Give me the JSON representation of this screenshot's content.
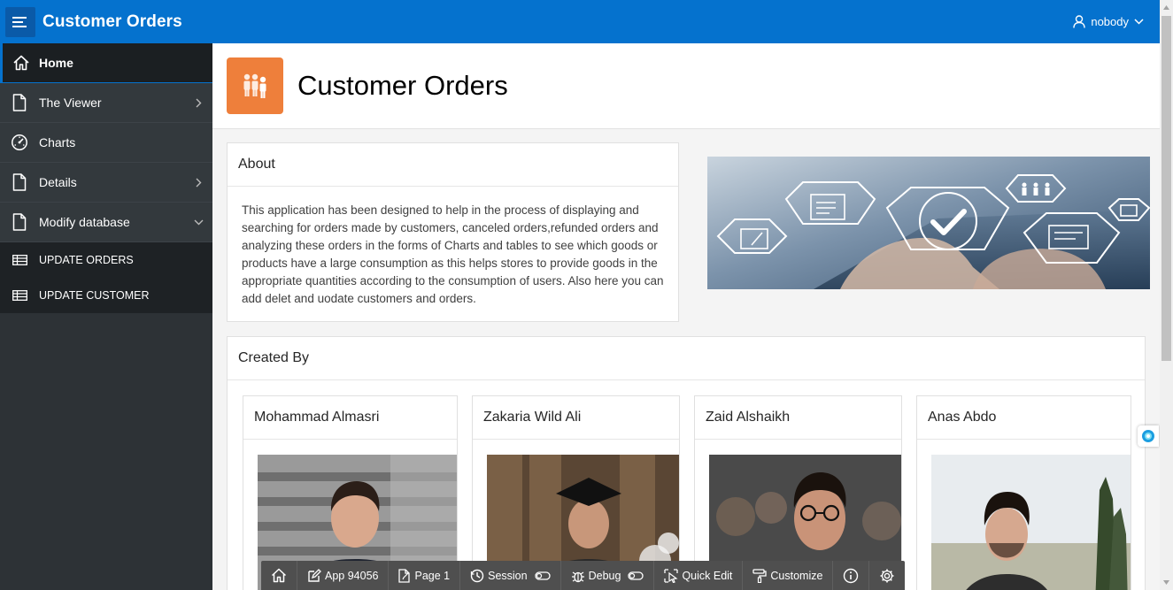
{
  "header": {
    "app_title": "Customer Orders",
    "user": "nobody"
  },
  "sidebar": {
    "items": [
      {
        "label": "Home",
        "icon": "home-icon"
      },
      {
        "label": "The Viewer",
        "icon": "file-icon"
      },
      {
        "label": "Charts",
        "icon": "gauge-icon"
      },
      {
        "label": "Details",
        "icon": "file-icon"
      },
      {
        "label": "Modify database",
        "icon": "file-icon"
      }
    ],
    "sub_items": [
      {
        "label": "UPDATE ORDERS",
        "icon": "table-icon"
      },
      {
        "label": "UPDATE CUSTOMER",
        "icon": "table-icon"
      }
    ]
  },
  "hero": {
    "title": "Customer Orders"
  },
  "about": {
    "title": "About",
    "body": "This application has been designed to help in the process of displaying and searching for orders made by customers, canceled orders,refunded orders and analyzing these orders in the forms of Charts and tables to see which goods or products have a large consumption as this helps stores to provide goods in the appropriate quantities according to the consumption of users. Also here you can add delet and uodate customers and orders."
  },
  "created_by": {
    "title": "Created By",
    "people": [
      {
        "name": "Mohammad Almasri"
      },
      {
        "name": "Zakaria Wild Ali"
      },
      {
        "name": "Zaid Alshaikh"
      },
      {
        "name": "Anas Abdo"
      }
    ]
  },
  "devbar": {
    "app": "App 94056",
    "page": "Page 1",
    "session": "Session",
    "debug": "Debug",
    "quick_edit": "Quick Edit",
    "customize": "Customize"
  },
  "colors": {
    "header": "#0572ce",
    "sidebar": "#2d3236",
    "hero_icon": "#ee7f3b"
  }
}
